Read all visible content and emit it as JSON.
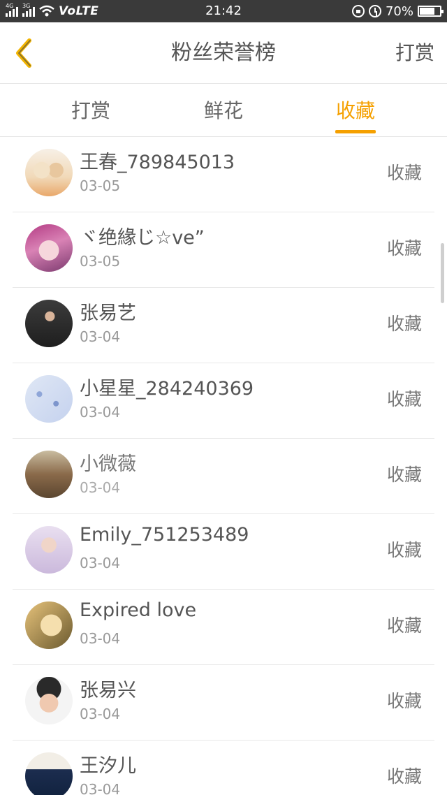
{
  "status_bar": {
    "network_1": "4G",
    "network_2": "3G",
    "carrier": "VoLTE",
    "time": "21:42",
    "battery_percent": "70%",
    "battery_level": 0.7
  },
  "header": {
    "title": "粉丝荣誉榜",
    "right_action": "打赏",
    "back_icon": "chevron-left-icon",
    "accent_color": "#f5a000"
  },
  "tabs": [
    {
      "label": "打赏",
      "active": false
    },
    {
      "label": "鲜花",
      "active": false
    },
    {
      "label": "收藏",
      "active": true
    }
  ],
  "list": {
    "items": [
      {
        "name": "王春_789845013",
        "date": "03-05",
        "action": "收藏"
      },
      {
        "name": "ヾ绝緣じ☆ve”",
        "date": "03-05",
        "action": "收藏"
      },
      {
        "name": "张易艺",
        "date": "03-04",
        "action": "收藏"
      },
      {
        "name": "小星星_284240369",
        "date": "03-04",
        "action": "收藏"
      },
      {
        "name": "小微薇",
        "date": "03-04",
        "action": "收藏"
      },
      {
        "name": "Emily_751253489",
        "date": "03-04",
        "action": "收藏"
      },
      {
        "name": "Expired love",
        "date": "03-04",
        "action": "收藏"
      },
      {
        "name": "张易兴",
        "date": "03-04",
        "action": "收藏"
      },
      {
        "name": "王汐儿",
        "date": "03-04",
        "action": "收藏"
      }
    ]
  }
}
